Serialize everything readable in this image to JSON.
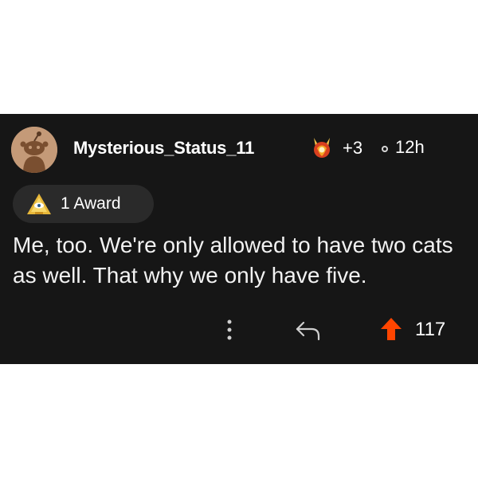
{
  "comment": {
    "author": "Mysterious_Status_11",
    "author_flair_icon": "award-flair-icon",
    "award_extra_count": "+3",
    "timestamp": "12h",
    "awards_label": "1 Award",
    "body": "Me, too. We're only allowed to have two cats as well. That why we only have five.",
    "vote_count": "117"
  },
  "icons": {
    "avatar": "snoo-avatar-icon",
    "more": "more-options-icon",
    "reply": "reply-icon",
    "upvote": "upvote-arrow-icon",
    "award": "award-badge-icon"
  },
  "colors": {
    "card_background": "#161616",
    "upvote": "#ff4500",
    "avatar_background": "#c49a78",
    "award_pill_background": "#2a2a2a"
  }
}
